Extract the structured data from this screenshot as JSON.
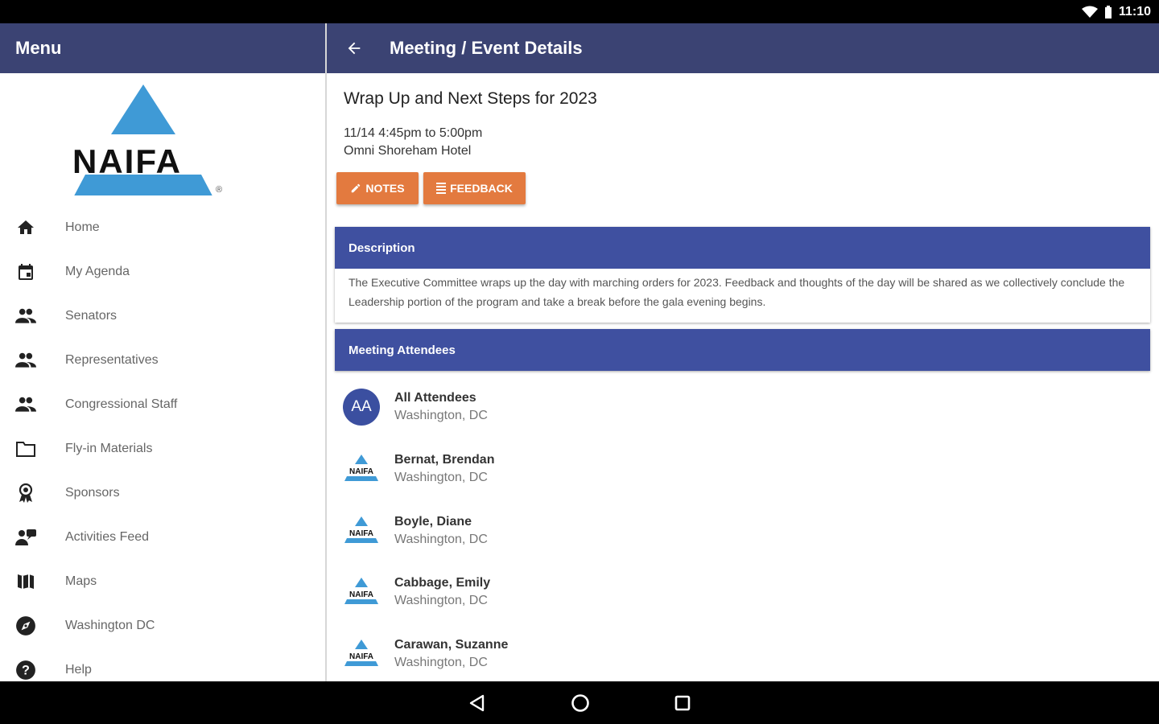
{
  "status": {
    "time": "11:10"
  },
  "menu": {
    "title": "Menu"
  },
  "brand": {
    "logo_text": "NAIFA",
    "color": "#3f9ad6"
  },
  "header": {
    "title": "Meeting / Event Details"
  },
  "sidebar": {
    "items": [
      {
        "label": "Home",
        "icon": "home-icon"
      },
      {
        "label": "My Agenda",
        "icon": "calendar-icon"
      },
      {
        "label": "Senators",
        "icon": "people-icon"
      },
      {
        "label": "Representatives",
        "icon": "people-icon"
      },
      {
        "label": "Congressional Staff",
        "icon": "people-icon"
      },
      {
        "label": "Fly-in Materials",
        "icon": "folder-icon"
      },
      {
        "label": "Sponsors",
        "icon": "award-icon"
      },
      {
        "label": "Activities Feed",
        "icon": "feed-icon"
      },
      {
        "label": "Maps",
        "icon": "map-icon"
      },
      {
        "label": "Washington DC",
        "icon": "compass-icon"
      },
      {
        "label": "Help",
        "icon": "help-icon"
      }
    ]
  },
  "event": {
    "title": "Wrap Up and Next Steps for 2023",
    "time": "11/14 4:45pm to 5:00pm",
    "location": "Omni Shoreham Hotel",
    "notes_label": "NOTES",
    "feedback_label": "FEEDBACK"
  },
  "description": {
    "heading": "Description",
    "text": "The Executive Committee wraps up the day with marching orders for 2023. Feedback and thoughts of the day will be shared as we collectively conclude the Leadership portion of the program and take a break before the gala evening begins."
  },
  "attendees": {
    "heading": "Meeting Attendees",
    "list": [
      {
        "initials": "AA",
        "name": "All Attendees",
        "city": "Washington, DC"
      },
      {
        "name": "Bernat, Brendan",
        "city": "Washington, DC"
      },
      {
        "name": "Boyle, Diane",
        "city": "Washington, DC"
      },
      {
        "name": "Cabbage, Emily",
        "city": "Washington, DC"
      },
      {
        "name": "Carawan, Suzanne",
        "city": "Washington, DC"
      }
    ]
  },
  "colors": {
    "header": "#3b4373",
    "section": "#3f50a0",
    "button": "#e37a3f"
  }
}
